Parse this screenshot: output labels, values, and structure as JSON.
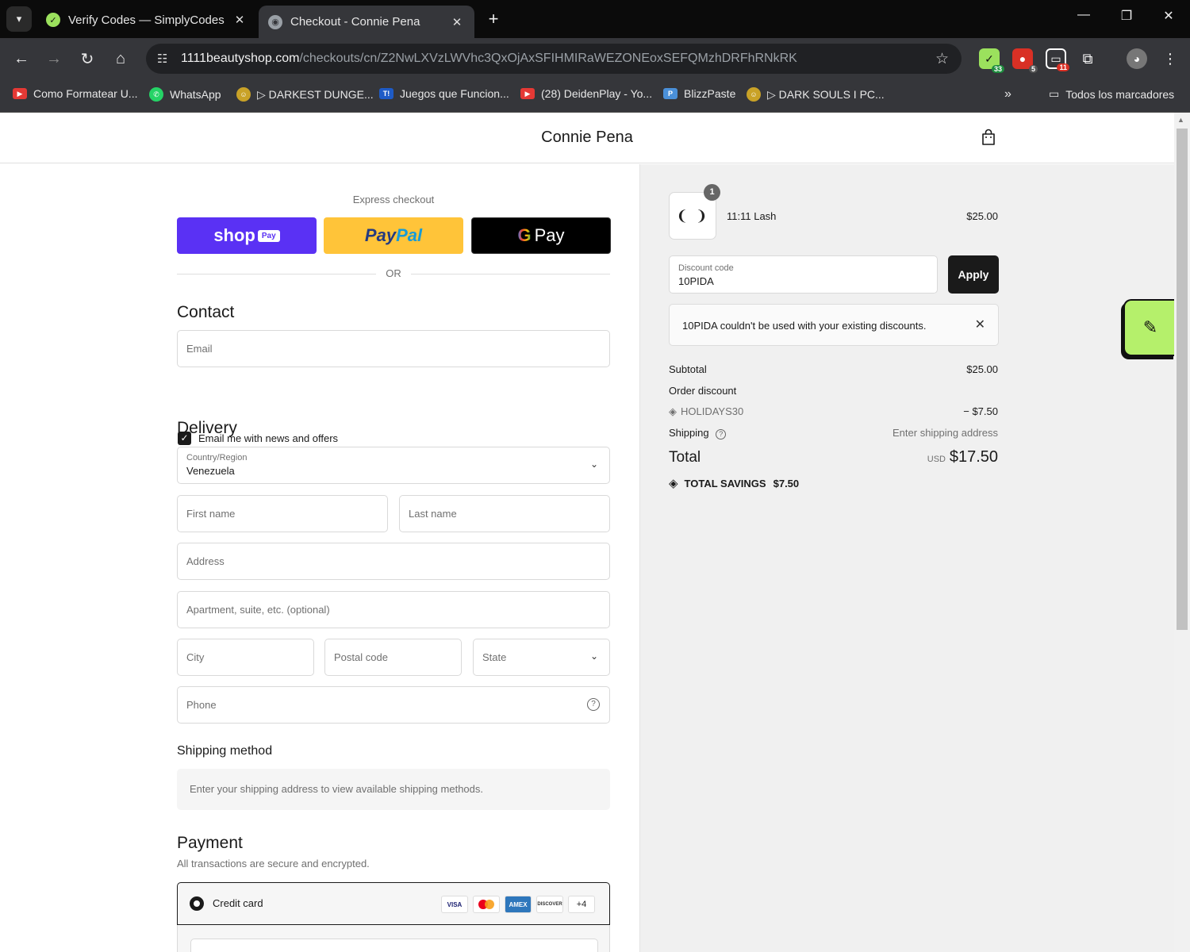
{
  "browser": {
    "tabs": [
      {
        "title": "Verify Codes — SimplyCodes",
        "active": false
      },
      {
        "title": "Checkout - Connie Pena",
        "active": true
      }
    ],
    "url_host": "1111beautyshop.com",
    "url_path": "/checkouts/cn/Z2NwLXVzLWVhc3QxOjAxSFIHMIRaWEZONEoxSEFQMzhDRFhRNkRK",
    "extension_badges": [
      "33",
      "5",
      "11"
    ],
    "bookmarks": [
      "Como Formatear U...",
      "WhatsApp",
      "▷ DARKEST DUNGE...",
      "Juegos que Funcion...",
      "(28) DeidenPlay - Yo...",
      "BlizzPaste",
      "▷ DARK SOULS I PC..."
    ],
    "bookmarks_overflow": "»",
    "all_bookmarks": "Todos los marcadores"
  },
  "header": {
    "store_name": "Connie Pena"
  },
  "express": {
    "label": "Express checkout",
    "shop_label": "shop",
    "shop_pill": "Pay",
    "paypal_a": "Pay",
    "paypal_b": "Pal",
    "gpay_g": "G",
    "gpay_label": "Pay",
    "or": "OR"
  },
  "contact": {
    "heading": "Contact",
    "email_placeholder": "Email",
    "newsletter_label": "Email me with news and offers",
    "newsletter_checked": true
  },
  "delivery": {
    "heading": "Delivery",
    "country_label": "Country/Region",
    "country_value": "Venezuela",
    "first_name_placeholder": "First name",
    "last_name_placeholder": "Last name",
    "address_placeholder": "Address",
    "apartment_placeholder": "Apartment, suite, etc. (optional)",
    "city_placeholder": "City",
    "postal_placeholder": "Postal code",
    "state_label": "State",
    "phone_placeholder": "Phone"
  },
  "shipping_method": {
    "heading": "Shipping method",
    "message": "Enter your shipping address to view available shipping methods."
  },
  "payment": {
    "heading": "Payment",
    "subtitle": "All transactions are secure and encrypted.",
    "method_label": "Credit card",
    "cards": [
      "VISA",
      "MC",
      "AMEX",
      "DISCOVER"
    ],
    "more_cards": "+4"
  },
  "summary": {
    "item": {
      "name": "11:11 Lash",
      "quantity": "1",
      "price": "$25.00"
    },
    "discount_label": "Discount code",
    "discount_value": "10PIDA",
    "apply_label": "Apply",
    "error_message": "10PIDA couldn't be used with your existing discounts.",
    "subtotal_label": "Subtotal",
    "subtotal_value": "$25.00",
    "order_discount_label": "Order discount",
    "discount_code": "HOLIDAYS30",
    "discount_amount": "− $7.50",
    "shipping_label": "Shipping",
    "shipping_value": "Enter shipping address",
    "total_label": "Total",
    "total_currency": "USD",
    "total_value": "$17.50",
    "savings_label": "TOTAL SAVINGS",
    "savings_value": "$7.50"
  },
  "colors": {
    "shop_pay": "#5a31f4",
    "paypal": "#ffc439",
    "widget": "#b5f06b"
  }
}
